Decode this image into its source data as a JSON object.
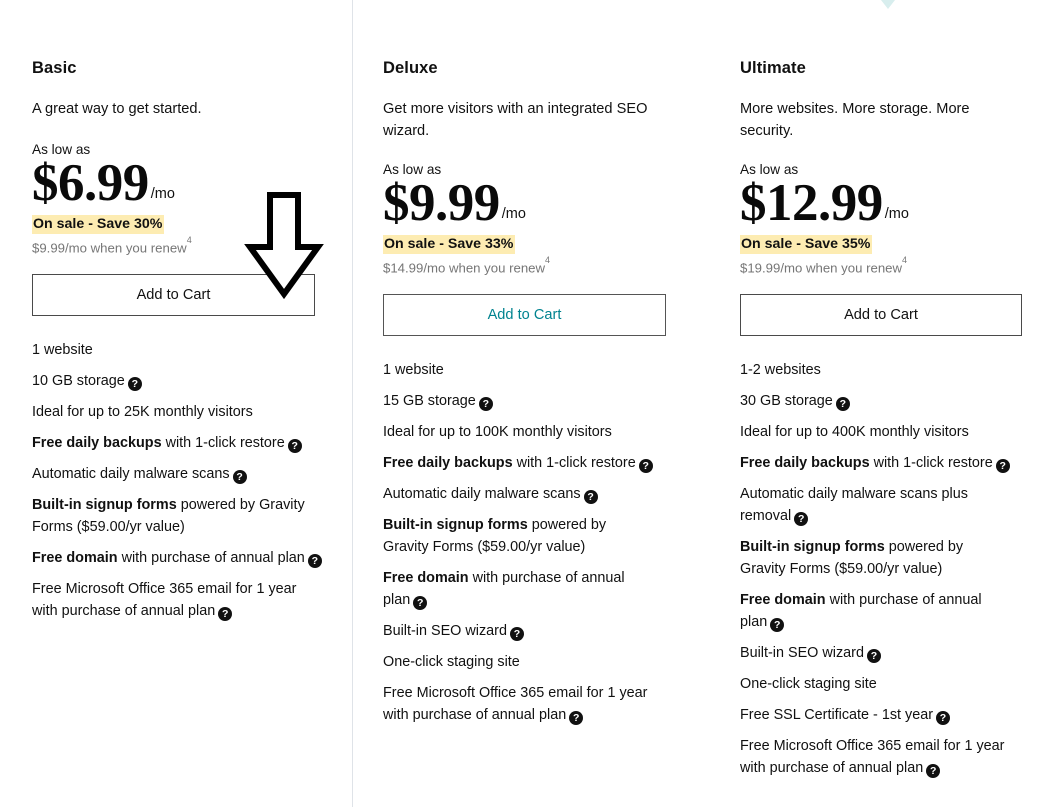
{
  "annotation": {
    "arrow_icon": "down-arrow-annotation",
    "points_at": "Add to Cart"
  },
  "badge": {
    "tip_color": "#d8eeee"
  },
  "colors": {
    "sale_highlight": "#fdecb2",
    "renew_text": "#767676",
    "deluxe_cta_text": "#00838f",
    "divider": "#dfe3e8"
  },
  "icons": {
    "help": "?"
  },
  "plans": [
    {
      "name": "Basic",
      "description": "A great way to get started.",
      "as_low_as": "As low as",
      "price": "$6.99",
      "per": "/mo",
      "sale": "On sale - Save 30%",
      "renew": "$9.99/mo when you renew",
      "renew_footnote": "4",
      "cta": "Add to Cart",
      "features": [
        {
          "bold": "",
          "text": "1 website",
          "help": false
        },
        {
          "bold": "",
          "text": "10 GB storage",
          "help": true
        },
        {
          "bold": "",
          "text": "Ideal for up to 25K monthly visitors",
          "help": false
        },
        {
          "bold": "Free daily backups",
          "text": " with 1-click restore",
          "help": true
        },
        {
          "bold": "",
          "text": "Automatic daily malware scans",
          "help": true
        },
        {
          "bold": "Built-in signup forms",
          "text": " powered by Gravity Forms ($59.00/yr value)",
          "help": false
        },
        {
          "bold": "Free domain",
          "text": " with purchase of annual plan",
          "help": true
        },
        {
          "bold": "",
          "text": "Free Microsoft Office 365 email for 1 year with purchase of annual plan",
          "help": true
        }
      ]
    },
    {
      "name": "Deluxe",
      "description": "Get more visitors with an integrated SEO wizard.",
      "as_low_as": "As low as",
      "price": "$9.99",
      "per": "/mo",
      "sale": "On sale - Save 33%",
      "renew": "$14.99/mo when you renew",
      "renew_footnote": "4",
      "cta": "Add to Cart",
      "features": [
        {
          "bold": "",
          "text": "1 website",
          "help": false
        },
        {
          "bold": "",
          "text": "15 GB storage",
          "help": true
        },
        {
          "bold": "",
          "text": "Ideal for up to 100K monthly visitors",
          "help": false
        },
        {
          "bold": "Free daily backups",
          "text": " with 1-click restore",
          "help": true
        },
        {
          "bold": "",
          "text": "Automatic daily malware scans",
          "help": true
        },
        {
          "bold": "Built-in signup forms",
          "text": " powered by Gravity Forms ($59.00/yr value)",
          "help": false
        },
        {
          "bold": "Free domain",
          "text": " with purchase of annual plan",
          "help": true
        },
        {
          "bold": "",
          "text": "Built-in SEO wizard",
          "help": true
        },
        {
          "bold": "",
          "text": "One-click staging site",
          "help": false
        },
        {
          "bold": "",
          "text": "Free Microsoft Office 365 email for 1 year with purchase of annual plan",
          "help": true
        }
      ]
    },
    {
      "name": "Ultimate",
      "description": "More websites. More storage. More security.",
      "as_low_as": "As low as",
      "price": "$12.99",
      "per": "/mo",
      "sale": "On sale - Save 35%",
      "renew": "$19.99/mo when you renew",
      "renew_footnote": "4",
      "cta": "Add to Cart",
      "features": [
        {
          "bold": "",
          "text": "1-2 websites",
          "help": false
        },
        {
          "bold": "",
          "text": "30 GB storage",
          "help": true
        },
        {
          "bold": "",
          "text": "Ideal for up to 400K monthly visitors",
          "help": false
        },
        {
          "bold": "Free daily backups",
          "text": " with 1-click restore",
          "help": true
        },
        {
          "bold": "",
          "text": "Automatic daily malware scans plus removal",
          "help": true
        },
        {
          "bold": "Built-in signup forms",
          "text": " powered by Gravity Forms ($59.00/yr value)",
          "help": false
        },
        {
          "bold": "Free domain",
          "text": " with purchase of annual plan",
          "help": true
        },
        {
          "bold": "",
          "text": "Built-in SEO wizard",
          "help": true
        },
        {
          "bold": "",
          "text": "One-click staging site",
          "help": false
        },
        {
          "bold": "",
          "text": "Free SSL Certificate - 1st year",
          "help": true
        },
        {
          "bold": "",
          "text": "Free Microsoft Office 365 email for 1 year with purchase of annual plan",
          "help": true
        }
      ]
    }
  ]
}
